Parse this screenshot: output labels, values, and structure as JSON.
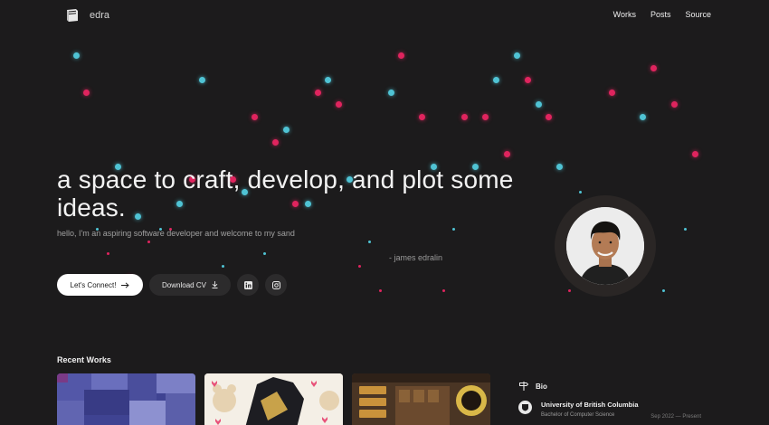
{
  "nav": {
    "brand": "edra",
    "links": [
      "Works",
      "Posts",
      "Source"
    ]
  },
  "hero": {
    "title": "a space to craft, develop, and plot some ideas.",
    "subtitle": "hello, I'm an aspiring software developer and welcome to my sand",
    "signature": "- james edralin"
  },
  "actions": {
    "connect_label": "Let's Connect!",
    "connect_icon": "arrow-right-icon",
    "download_label": "Download CV",
    "download_icon": "download-icon",
    "linkedin_icon": "linkedin-icon",
    "instagram_icon": "instagram-icon"
  },
  "recent_works": {
    "title": "Recent Works",
    "cards": [
      "work-card-1",
      "work-card-2",
      "work-card-3"
    ]
  },
  "bio": {
    "title": "Bio",
    "education": {
      "school": "University of British Columbia",
      "degree": "Bachelor of Computer Science",
      "dates": "Sep 2022 — Present"
    }
  },
  "colors": {
    "background": "#1c1b1c",
    "dot_pink": "#e0245e",
    "dot_cyan": "#4fc3d4"
  }
}
